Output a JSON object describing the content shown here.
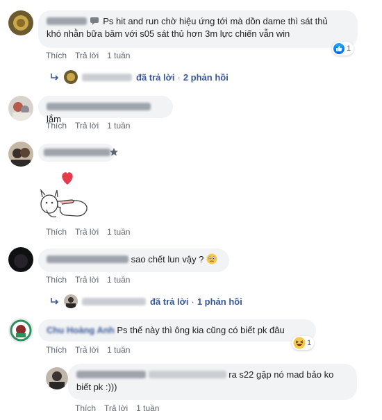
{
  "comments": [
    {
      "id": "c1",
      "text_line1": "Ps hit and run chờ hiệu ứng tới mà dồn dame thì sát thủ",
      "text_line2": "khó nhằn bữa băm với s05 sát thủ hơn 3m lực chiến vẫn win",
      "actions": {
        "like": "Thích",
        "reply": "Trả lời",
        "time": "1 tuần"
      },
      "reaction_count": "1",
      "reply_summary": {
        "replied": "đã trả lời",
        "count": "2 phản hồi"
      }
    },
    {
      "id": "c2",
      "text": "lắm",
      "actions": {
        "like": "Thích",
        "reply": "Trả lời",
        "time": "1 tuần"
      }
    },
    {
      "id": "c3",
      "actions": {
        "like": "Thích",
        "reply": "Trả lời",
        "time": "1 tuần"
      }
    },
    {
      "id": "c4",
      "text": "sao chết lun vậy ?",
      "actions": {
        "like": "Thích",
        "reply": "Trả lời",
        "time": "1 tuần"
      },
      "reply_summary": {
        "replied": "đã trả lời",
        "count": "1 phản hồi"
      }
    },
    {
      "id": "c5",
      "name": "Chu Hoàng Anh",
      "text": "Ps thế này thì ông kia cũng có biết pk đâu",
      "actions": {
        "like": "Thích",
        "reply": "Trả lời",
        "time": "1 tuần"
      },
      "reaction_count": "1"
    },
    {
      "id": "c6",
      "text_line1": "ra s22 gặp nó mad bảo ko",
      "text_line2": "biết pk :)))",
      "actions": {
        "like": "Thích",
        "reply": "Trả lời",
        "time": "1 tuần"
      }
    }
  ],
  "separator": "·",
  "colors": {
    "bubble": "#f2f3f5",
    "link": "#385898",
    "meta": "#606770",
    "like_blue": "#0a7cff"
  }
}
